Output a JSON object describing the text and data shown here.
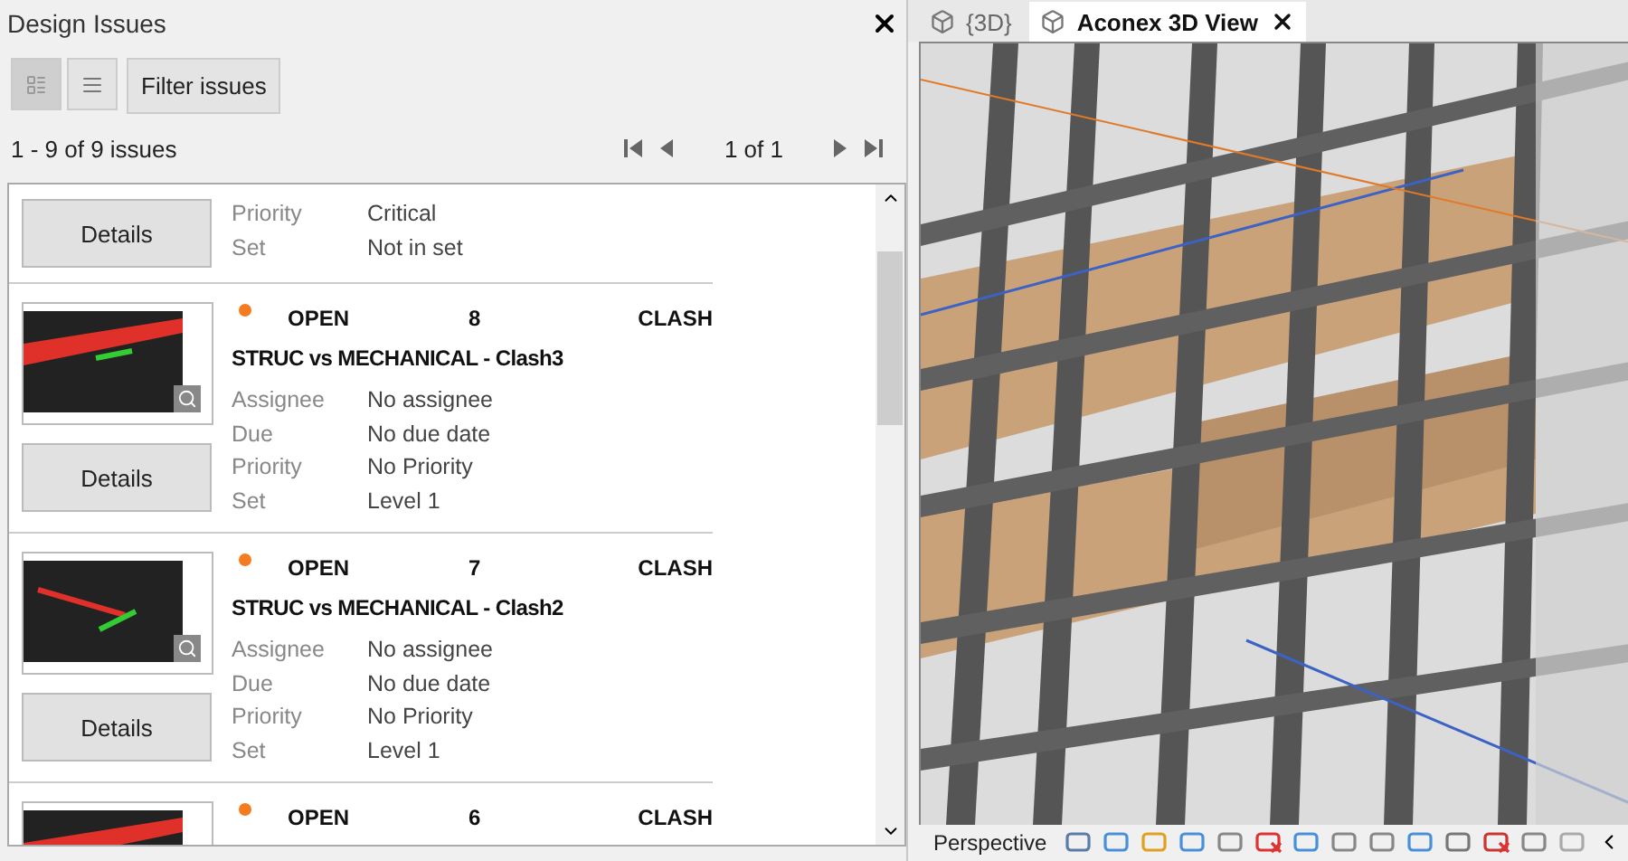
{
  "panel": {
    "title": "Design Issues",
    "view_buttons": [
      {
        "kind": "cards",
        "selected": true
      },
      {
        "kind": "list",
        "selected": false
      }
    ],
    "filter_button": "Filter issues",
    "count": "1 - 9 of 9 issues",
    "page": "1 of 1"
  },
  "partial_issue": {
    "details": "Details",
    "fields": [
      {
        "label": "Priority",
        "value": "Critical"
      },
      {
        "label": "Set",
        "value": "Not in set"
      }
    ]
  },
  "issues": [
    {
      "status": "OPEN",
      "number": "8",
      "type": "CLASH",
      "title": "STRUC vs MECHANICAL - Clash3",
      "details": "Details",
      "fields": [
        {
          "label": "Assignee",
          "value": "No assignee"
        },
        {
          "label": "Due",
          "value": "No due date"
        },
        {
          "label": "Priority",
          "value": "No Priority"
        },
        {
          "label": "Set",
          "value": "Level 1"
        }
      ]
    },
    {
      "status": "OPEN",
      "number": "7",
      "type": "CLASH",
      "title": "STRUC vs MECHANICAL - Clash2",
      "details": "Details",
      "fields": [
        {
          "label": "Assignee",
          "value": "No assignee"
        },
        {
          "label": "Due",
          "value": "No due date"
        },
        {
          "label": "Priority",
          "value": "No Priority"
        },
        {
          "label": "Set",
          "value": "Level 1"
        }
      ]
    },
    {
      "status": "OPEN",
      "number": "6",
      "type": "CLASH"
    }
  ],
  "viewer": {
    "tabs": [
      {
        "label": "{3D}",
        "selected": false
      },
      {
        "label": "Aconex 3D View",
        "selected": true
      }
    ],
    "mode": "Perspective"
  }
}
